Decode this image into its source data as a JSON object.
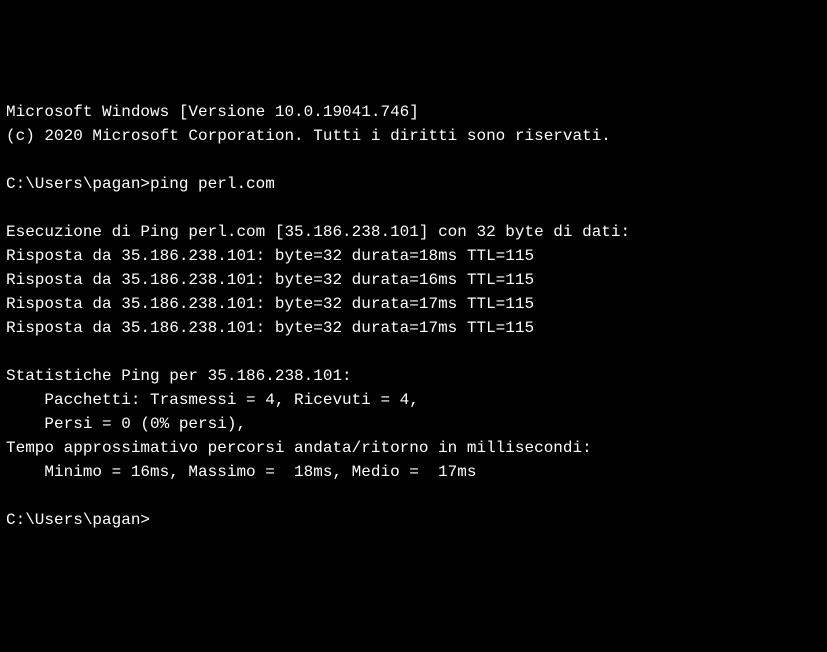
{
  "header": {
    "version_line": "Microsoft Windows [Versione 10.0.19041.746]",
    "copyright_line": "(c) 2020 Microsoft Corporation. Tutti i diritti sono riservati."
  },
  "session": {
    "prompt1": "C:\\Users\\pagan>",
    "command1": "ping perl.com",
    "prompt2": "C:\\Users\\pagan>"
  },
  "ping": {
    "exec_line": "Esecuzione di Ping perl.com [35.186.238.101] con 32 byte di dati:",
    "replies": [
      "Risposta da 35.186.238.101: byte=32 durata=18ms TTL=115",
      "Risposta da 35.186.238.101: byte=32 durata=16ms TTL=115",
      "Risposta da 35.186.238.101: byte=32 durata=17ms TTL=115",
      "Risposta da 35.186.238.101: byte=32 durata=17ms TTL=115"
    ],
    "stats_header": "Statistiche Ping per 35.186.238.101:",
    "packets_line": "    Pacchetti: Trasmessi = 4, Ricevuti = 4,",
    "lost_line": "    Persi = 0 (0% persi),",
    "rtt_header": "Tempo approssimativo percorsi andata/ritorno in millisecondi:",
    "rtt_values": "    Minimo = 16ms, Massimo =  18ms, Medio =  17ms"
  }
}
